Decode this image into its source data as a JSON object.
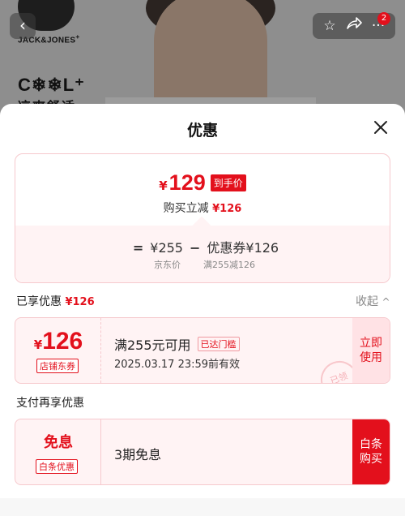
{
  "header": {
    "brand": "JACK&JONES",
    "brand_sup": "+",
    "promo_title": "C❄❄L⁺",
    "promo_sub": "凉爽舒适",
    "back_icon": "chevron-left",
    "cart_badge": "2"
  },
  "sheet": {
    "title": "优惠",
    "final_price": {
      "currency": "¥",
      "value": "129",
      "tag": "到手价"
    },
    "reduction": {
      "label": "购买立减",
      "amount": "¥126"
    },
    "formula": {
      "equals": "=",
      "base": "¥255",
      "minus": "−",
      "coupon": "优惠券¥126",
      "base_caption": "京东价",
      "coupon_caption": "满255减126"
    },
    "enjoyed": {
      "label": "已享优惠",
      "amount": "¥126",
      "collapse_label": "收起"
    },
    "coupon": {
      "currency": "¥",
      "amount": "126",
      "type_tag": "店铺东券",
      "condition": "满255元可用",
      "reached_tag": "已达门槛",
      "expiry": "2025.03.17 23:59前有效",
      "action_line1": "立即",
      "action_line2": "使用",
      "stamp": "已领"
    },
    "pay": {
      "label": "支付再享优惠"
    },
    "installment": {
      "title": "免息",
      "tag": "白条优惠",
      "desc": "3期免息",
      "action_line1": "白条",
      "action_line2": "购买"
    }
  },
  "colors": {
    "accent": "#e3101c",
    "pink_bg": "#fff3f4",
    "pink_border": "#f6c9cd"
  }
}
